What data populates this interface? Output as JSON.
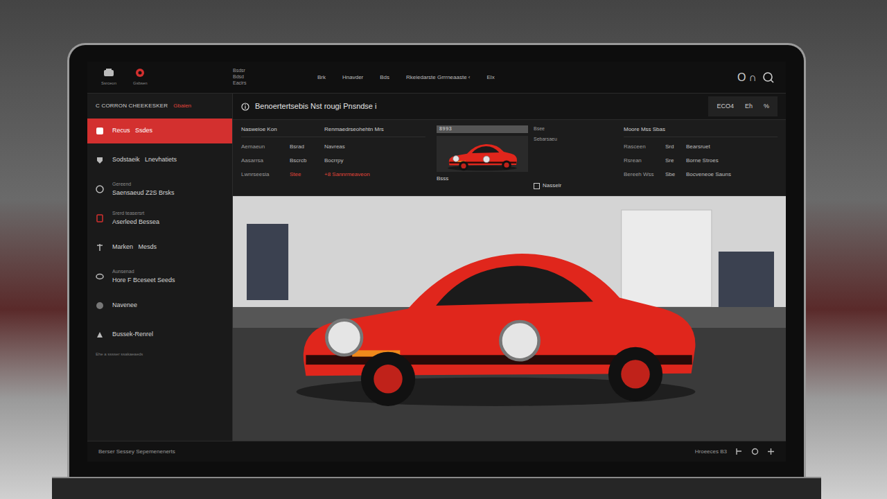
{
  "top_bar": {
    "apps": [
      {
        "label": "Ssrceon"
      },
      {
        "label": "Gsbsen"
      }
    ],
    "brand": [
      "Bsdsr",
      "Bdsd",
      "Eacirs"
    ],
    "nav": [
      {
        "label": "Brk"
      },
      {
        "label": "Hnavder"
      },
      {
        "label": "Bds"
      },
      {
        "label": "Rkeiedarste Grrrneaaste ‹"
      },
      {
        "label": "Elx"
      }
    ],
    "controls": [
      "O",
      "∩"
    ]
  },
  "sidebar": {
    "title": "C CORRON CHEEKESKER",
    "badge": "Gbaien",
    "items": [
      {
        "label": "Recus   Ssdes",
        "selected": true
      },
      {
        "label": "Sodstaeik   Lnevhatiets",
        "selected": false
      },
      {
        "sub": "Gereend",
        "label": "Saensaeud Z2S Brsks",
        "selected": false
      },
      {
        "sub": "Srerd teasersrt",
        "label": "Aserleed Bessea",
        "selected": false
      },
      {
        "label": "Marken   Mesds",
        "selected": false
      },
      {
        "sub": "Aunsenad",
        "label": "Hore F Bceseet Seeds",
        "selected": false
      },
      {
        "label": "Navenee",
        "selected": false
      },
      {
        "label": "Bussek-Renrel",
        "selected": false
      }
    ],
    "note": "Ehe a sssser ssakaeaeds"
  },
  "header": {
    "title": "Benoertertsebis Nst rougi Pnsndse i",
    "stats": [
      "ECO4",
      "Eh",
      "%"
    ]
  },
  "details": {
    "left_header": [
      "Nasweioe Kon",
      "Renmaedrseohehtn Mrs"
    ],
    "left_rows": [
      {
        "label": "Aemaeun",
        "value": "Bsrad",
        "extra": "Navreas",
        "accent": false
      },
      {
        "label": "Aasarrsa",
        "value": "Bscrcb",
        "extra": "Bocrrpy",
        "accent": false
      },
      {
        "label": "Lwnrseesia",
        "value": "Stee",
        "extra": "+8 Sannrmeaveon",
        "accent": true
      }
    ],
    "card": {
      "code": "8993",
      "caption": "Bsss",
      "tag": "Nasselr",
      "meta": [
        "Bsee",
        "Sebarsaeu"
      ]
    },
    "right_header": "Moore Mss Sbas",
    "right_rows": [
      {
        "label": "Rasceen",
        "value": "Srd",
        "extra": "Bearsruet"
      },
      {
        "label": "Rsrean",
        "value": "Sre",
        "extra": "Borne Stroes"
      },
      {
        "label": "Bereeh Wss",
        "value": "Sbe",
        "extra": "Bocveneoe Sauns"
      }
    ]
  },
  "footer": {
    "left": "Berser Sessey Sepemenenerts",
    "right": "Hroeeces B3"
  }
}
